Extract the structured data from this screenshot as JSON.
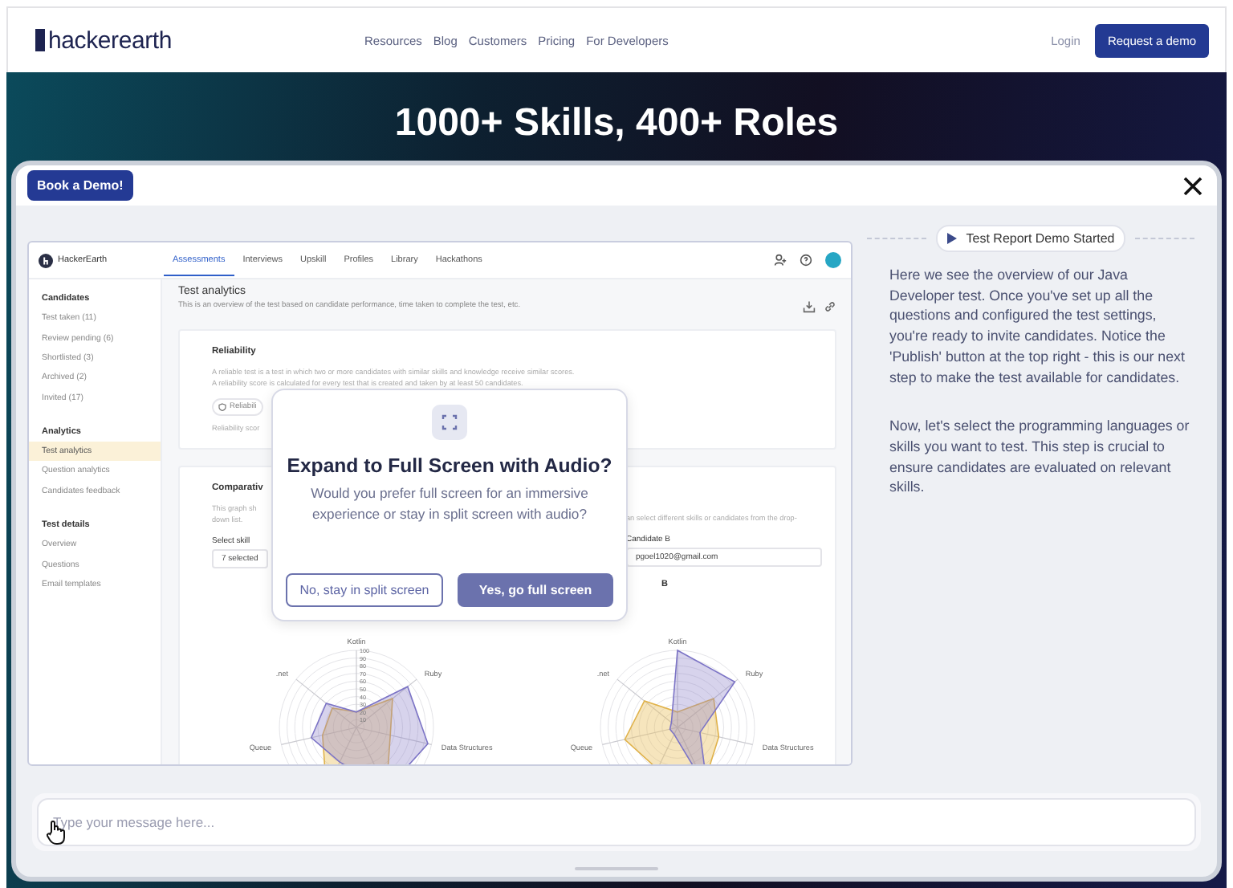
{
  "site_header": {
    "logo": "hackerearth",
    "nav": [
      "Resources",
      "Blog",
      "Customers",
      "Pricing",
      "For Developers"
    ],
    "login": "Login",
    "cta": "Request a demo"
  },
  "hero": {
    "headline": "1000+ Skills, 400+ Roles"
  },
  "overlay": {
    "book_button": "Book a Demo!"
  },
  "app": {
    "logo_text": "HackerEarth",
    "tabs": [
      {
        "label": "Assessments",
        "selected": true
      },
      {
        "label": "Interviews",
        "selected": false
      },
      {
        "label": "Upskill",
        "selected": false
      },
      {
        "label": "Profiles",
        "selected": false
      },
      {
        "label": "Library",
        "selected": false
      },
      {
        "label": "Hackathons",
        "selected": false
      }
    ],
    "sidebar": [
      {
        "title": "Candidates",
        "items": [
          {
            "label": "Test taken (11)",
            "selected": false
          },
          {
            "label": "Review pending (6)",
            "selected": false
          },
          {
            "label": "Shortlisted (3)",
            "selected": false
          },
          {
            "label": "Archived (2)",
            "selected": false
          },
          {
            "label": "Invited (17)",
            "selected": false
          }
        ]
      },
      {
        "title": "Analytics",
        "items": [
          {
            "label": "Test analytics",
            "selected": true
          },
          {
            "label": "Question analytics",
            "selected": false
          },
          {
            "label": "Candidates feedback",
            "selected": false
          }
        ]
      },
      {
        "title": "Test details",
        "items": [
          {
            "label": "Overview",
            "selected": false
          },
          {
            "label": "Questions",
            "selected": false
          },
          {
            "label": "Email templates",
            "selected": false
          }
        ]
      }
    ],
    "page_title": "Test analytics",
    "page_subtitle": "This is an overview of the test based on candidate performance, time taken to complete the test, etc.",
    "reliability": {
      "title": "Reliability",
      "lines": [
        "A reliable test is a test in which two or more candidates with similar skills and knowledge receive similar scores.",
        "A reliability score is calculated for every test that is created and taken by at least 50 candidates."
      ],
      "chip": "Reliabili",
      "note": "Reliability scor"
    },
    "comparative": {
      "title": "Comparativ",
      "desc_left": [
        "This graph sh",
        "down list."
      ],
      "desc_right": "an select different skills or candidates from the drop-",
      "skill_label": "Select skill",
      "skill_value": "7 selected",
      "candidate_label": "Candidate B",
      "candidate_value": "pgoel1020@gmail.com",
      "legend": "B"
    },
    "radar_charts": [
      {
        "axes": [
          "Kotlin",
          "Ruby",
          "Data Structures",
          "Queue",
          ".net"
        ],
        "ticks": [
          "100",
          "90",
          "80",
          "70",
          "60",
          "50",
          "40",
          "30",
          "20",
          "10"
        ]
      },
      {
        "axes": [
          "Kotlin",
          "Ruby",
          "Data Structures",
          "Queue",
          ".net"
        ]
      }
    ]
  },
  "modal": {
    "title": "Expand to Full Screen with Audio?",
    "body": "Would you prefer full screen for an immersive experience or stay in split screen with audio?",
    "buttons": [
      {
        "label": "No, stay in split screen",
        "kind": "secondary"
      },
      {
        "label": "Yes, go full screen",
        "kind": "primary"
      }
    ]
  },
  "chat": {
    "status": "Test Report Demo Started",
    "messages": [
      "Here we see the overview of our Java Developer test. Once you've set up all the questions and configured the test settings, you're ready to invite candidates. Notice the 'Publish' button at the top right - this is our next step to make the test available for candidates.",
      "Now, let's select the programming languages or skills you want to test. This step is crucial to ensure candidates are evaluated on relevant skills."
    ]
  },
  "composer": {
    "placeholder": "Type your message here..."
  }
}
